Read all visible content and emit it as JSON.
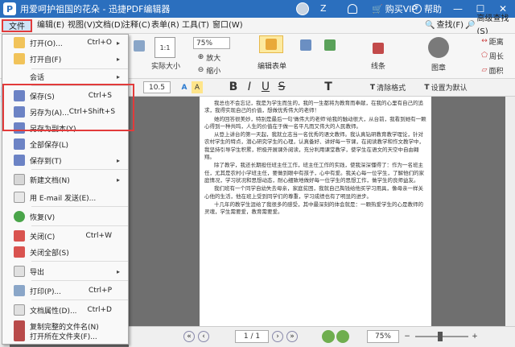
{
  "app": {
    "title": "用爱呵护祖国的花朵 - 迅捷PDF编辑器",
    "logo_letter": "P",
    "user": "Z",
    "vip": "购买VIP",
    "help": "帮助",
    "win_min": "—",
    "win_max": "☐",
    "win_close": "✕"
  },
  "menu": {
    "file": "文件",
    "edit": "编辑(E)",
    "view": "视图(V)",
    "doc": "文档(D)",
    "annot": "注释(C)",
    "form": "表单(R)",
    "tools": "工具(T)",
    "window": "窗口(W)",
    "find": "查找(F)",
    "adv_find": "高级查找(S)"
  },
  "ribbon": {
    "zoom": "75%",
    "actual_size": "实际大小",
    "zoom_in": "放大",
    "zoom_out": "缩小",
    "edit_form": "编辑表单",
    "lines": "线条",
    "stamp": "图章",
    "distance": "距离",
    "perimeter": "周长",
    "area": "面积",
    "page_num": "1/1"
  },
  "fmt": {
    "font_size": "10.5",
    "bold": "B",
    "italic": "I",
    "underline": "U",
    "strike": "S",
    "text": "T",
    "clear_fmt": "清除格式",
    "set_default": "设置为默认"
  },
  "dropdown": [
    {
      "label": "打开(O)...",
      "key": "Ctrl+O",
      "arrow": "▸"
    },
    {
      "label": "打开自(F)",
      "key": "",
      "arrow": "▸"
    },
    {
      "label": "会话",
      "key": "",
      "arrow": "▸"
    },
    {
      "label": "保存(S)",
      "key": "Ctrl+S",
      "arrow": ""
    },
    {
      "label": "另存为(A)...",
      "key": "Ctrl+Shift+S",
      "arrow": ""
    },
    {
      "label": "另存为副本(Y)...",
      "key": "",
      "arrow": ""
    },
    {
      "label": "全部保存(L)",
      "key": "",
      "arrow": ""
    },
    {
      "label": "保存到(T)",
      "key": "",
      "arrow": "▸"
    },
    {
      "label": "新建文档(N)",
      "key": "",
      "arrow": "▸"
    },
    {
      "label": "用 E-mail 发送(E)...",
      "key": "",
      "arrow": ""
    },
    {
      "label": "恢复(V)",
      "key": "",
      "arrow": ""
    },
    {
      "label": "关闭(C)",
      "key": "Ctrl+W",
      "arrow": ""
    },
    {
      "label": "关闭全部(S)",
      "key": "",
      "arrow": ""
    },
    {
      "label": "导出",
      "key": "",
      "arrow": "▸"
    },
    {
      "label": "打印(P)...",
      "key": "Ctrl+P",
      "arrow": ""
    },
    {
      "label": "文档属性(D)...",
      "key": "Ctrl+D",
      "arrow": ""
    },
    {
      "label": "复制完整的文件名(N)",
      "key": "",
      "arrow": ""
    },
    {
      "label": "打开所在文件夹(F)...",
      "key": "",
      "arrow": ""
    }
  ],
  "doc": {
    "paragraphs": [
      "我总也不会忘记，我是为学生而生的，我的一生都将为教育而奉献，在我的心里有自己的追求，我得实现自己的价值，想做优秀伟大的老师！",
      "她的回答很美妙，特别是最后一句'做伟大的老师'给我的触动很大，从台前，我看到她有一颗心得到一种共鸣，人生的价值在于做一名平凡而又伟大的人民教师。",
      "从登上讲台的第一天起，我就立志当一名优秀的语文教师。我认真钻研教育教学理论，针对农村学生的特点，潜心研究学生的心理，认真备好、讲好每一节课，在阅读教学和作文教学中，我坚持引导学生积累，积极开展课外阅读，充分利用课堂教学，使学生在语文的天空中自由翱翔。",
      "除了教学，我还长期担任班主任工作，班主任工作的实践，使我深深懂得了：作为一名班主任，尤其是农村小学班主任，要做到眼中有孩子，心中有爱。我关心每一位学生，了解他们的家庭情况，学习状况和思想动态，耐心细致地做好每一位学生的思想工作，做学生的良师益友。",
      "我们班有一个同学自幼失去母亲，家庭贫困，我就自己掏钱给他买学习用具，像母亲一样关心他的生活，他在班上受到同学们的尊重，学习成绩也有了明显的进步。",
      "十几年的教学生涯给了我很多的感受，其中最深刻的体会就是：一颗热爱学生的心是教师的灵魂，学生需要爱，教育需要爱。"
    ]
  },
  "status": {
    "zoom": "75%",
    "page": "1 / 1"
  }
}
